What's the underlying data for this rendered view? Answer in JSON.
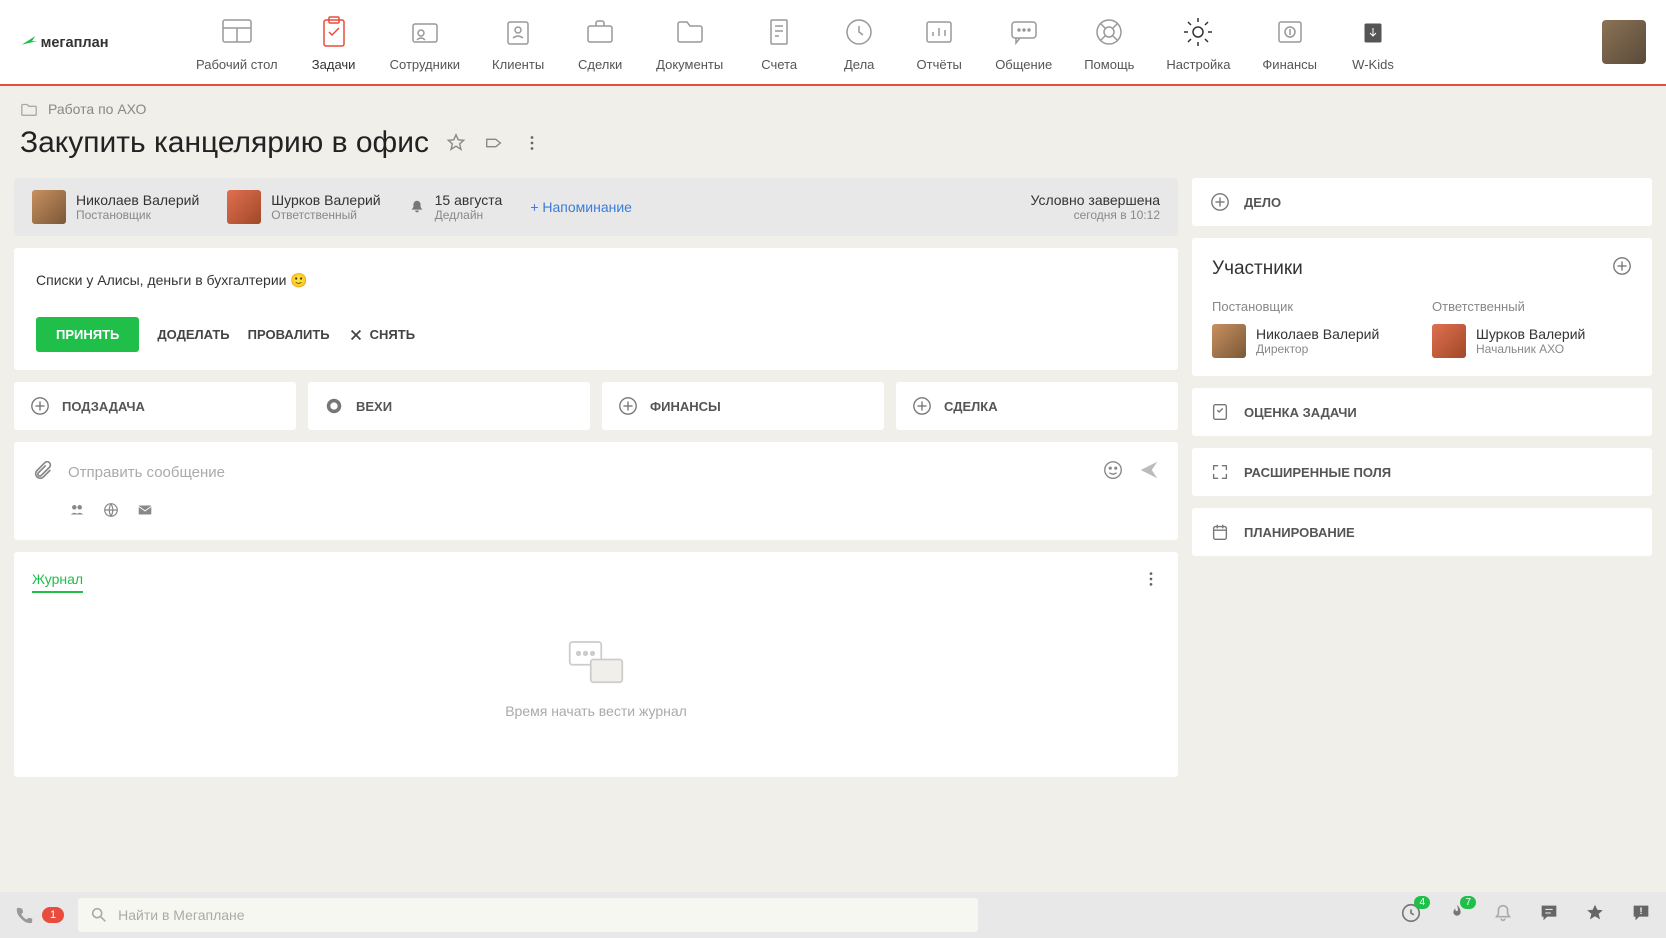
{
  "nav": {
    "items": [
      {
        "label": "Рабочий стол"
      },
      {
        "label": "Задачи"
      },
      {
        "label": "Сотрудники"
      },
      {
        "label": "Клиенты"
      },
      {
        "label": "Сделки"
      },
      {
        "label": "Документы"
      },
      {
        "label": "Счета"
      },
      {
        "label": "Дела"
      },
      {
        "label": "Отчёты"
      },
      {
        "label": "Общение"
      },
      {
        "label": "Помощь"
      },
      {
        "label": "Настройка"
      },
      {
        "label": "Финансы"
      },
      {
        "label": "W-Kids"
      }
    ]
  },
  "breadcrumb": "Работа по АХО",
  "title": "Закупить канцелярию в офис",
  "header": {
    "owner": {
      "name": "Николаев Валерий",
      "role": "Постановщик"
    },
    "assignee": {
      "name": "Шурков Валерий",
      "role": "Ответственный"
    },
    "deadline_date": "15 августа",
    "deadline_label": "Дедлайн",
    "reminder": "+ Напоминание",
    "status": "Условно завершена",
    "status_time": "сегодня в 10:12"
  },
  "description": "Списки у Алисы, деньги в бухгалтерии 🙂",
  "actions": {
    "accept": "ПРИНЯТЬ",
    "rework": "ДОДЕЛАТЬ",
    "fail": "ПРОВАЛИТЬ",
    "remove": "СНЯТЬ"
  },
  "tiles": {
    "subtask": "ПОДЗАДАЧА",
    "milestones": "ВЕХИ",
    "finances": "ФИНАНСЫ",
    "deal": "СДЕЛКА"
  },
  "message": {
    "placeholder": "Отправить сообщение"
  },
  "journal": {
    "tab": "Журнал",
    "empty": "Время начать вести журнал"
  },
  "side": {
    "delo": "ДЕЛО",
    "participants_title": "Участники",
    "owner_col": "Постановщик",
    "assignee_col": "Ответственный",
    "owner": {
      "name": "Николаев Валерий",
      "role": "Директор"
    },
    "assignee": {
      "name": "Шурков Валерий",
      "role": "Начальник АХО"
    },
    "evaluation": "ОЦЕНКА ЗАДАЧИ",
    "extended": "РАСШИРЕННЫЕ ПОЛЯ",
    "planning": "ПЛАНИРОВАНИЕ"
  },
  "bottom": {
    "phone_count": "1",
    "search_placeholder": "Найти в Мегаплане",
    "clock_badge": "4",
    "fire_badge": "7"
  }
}
